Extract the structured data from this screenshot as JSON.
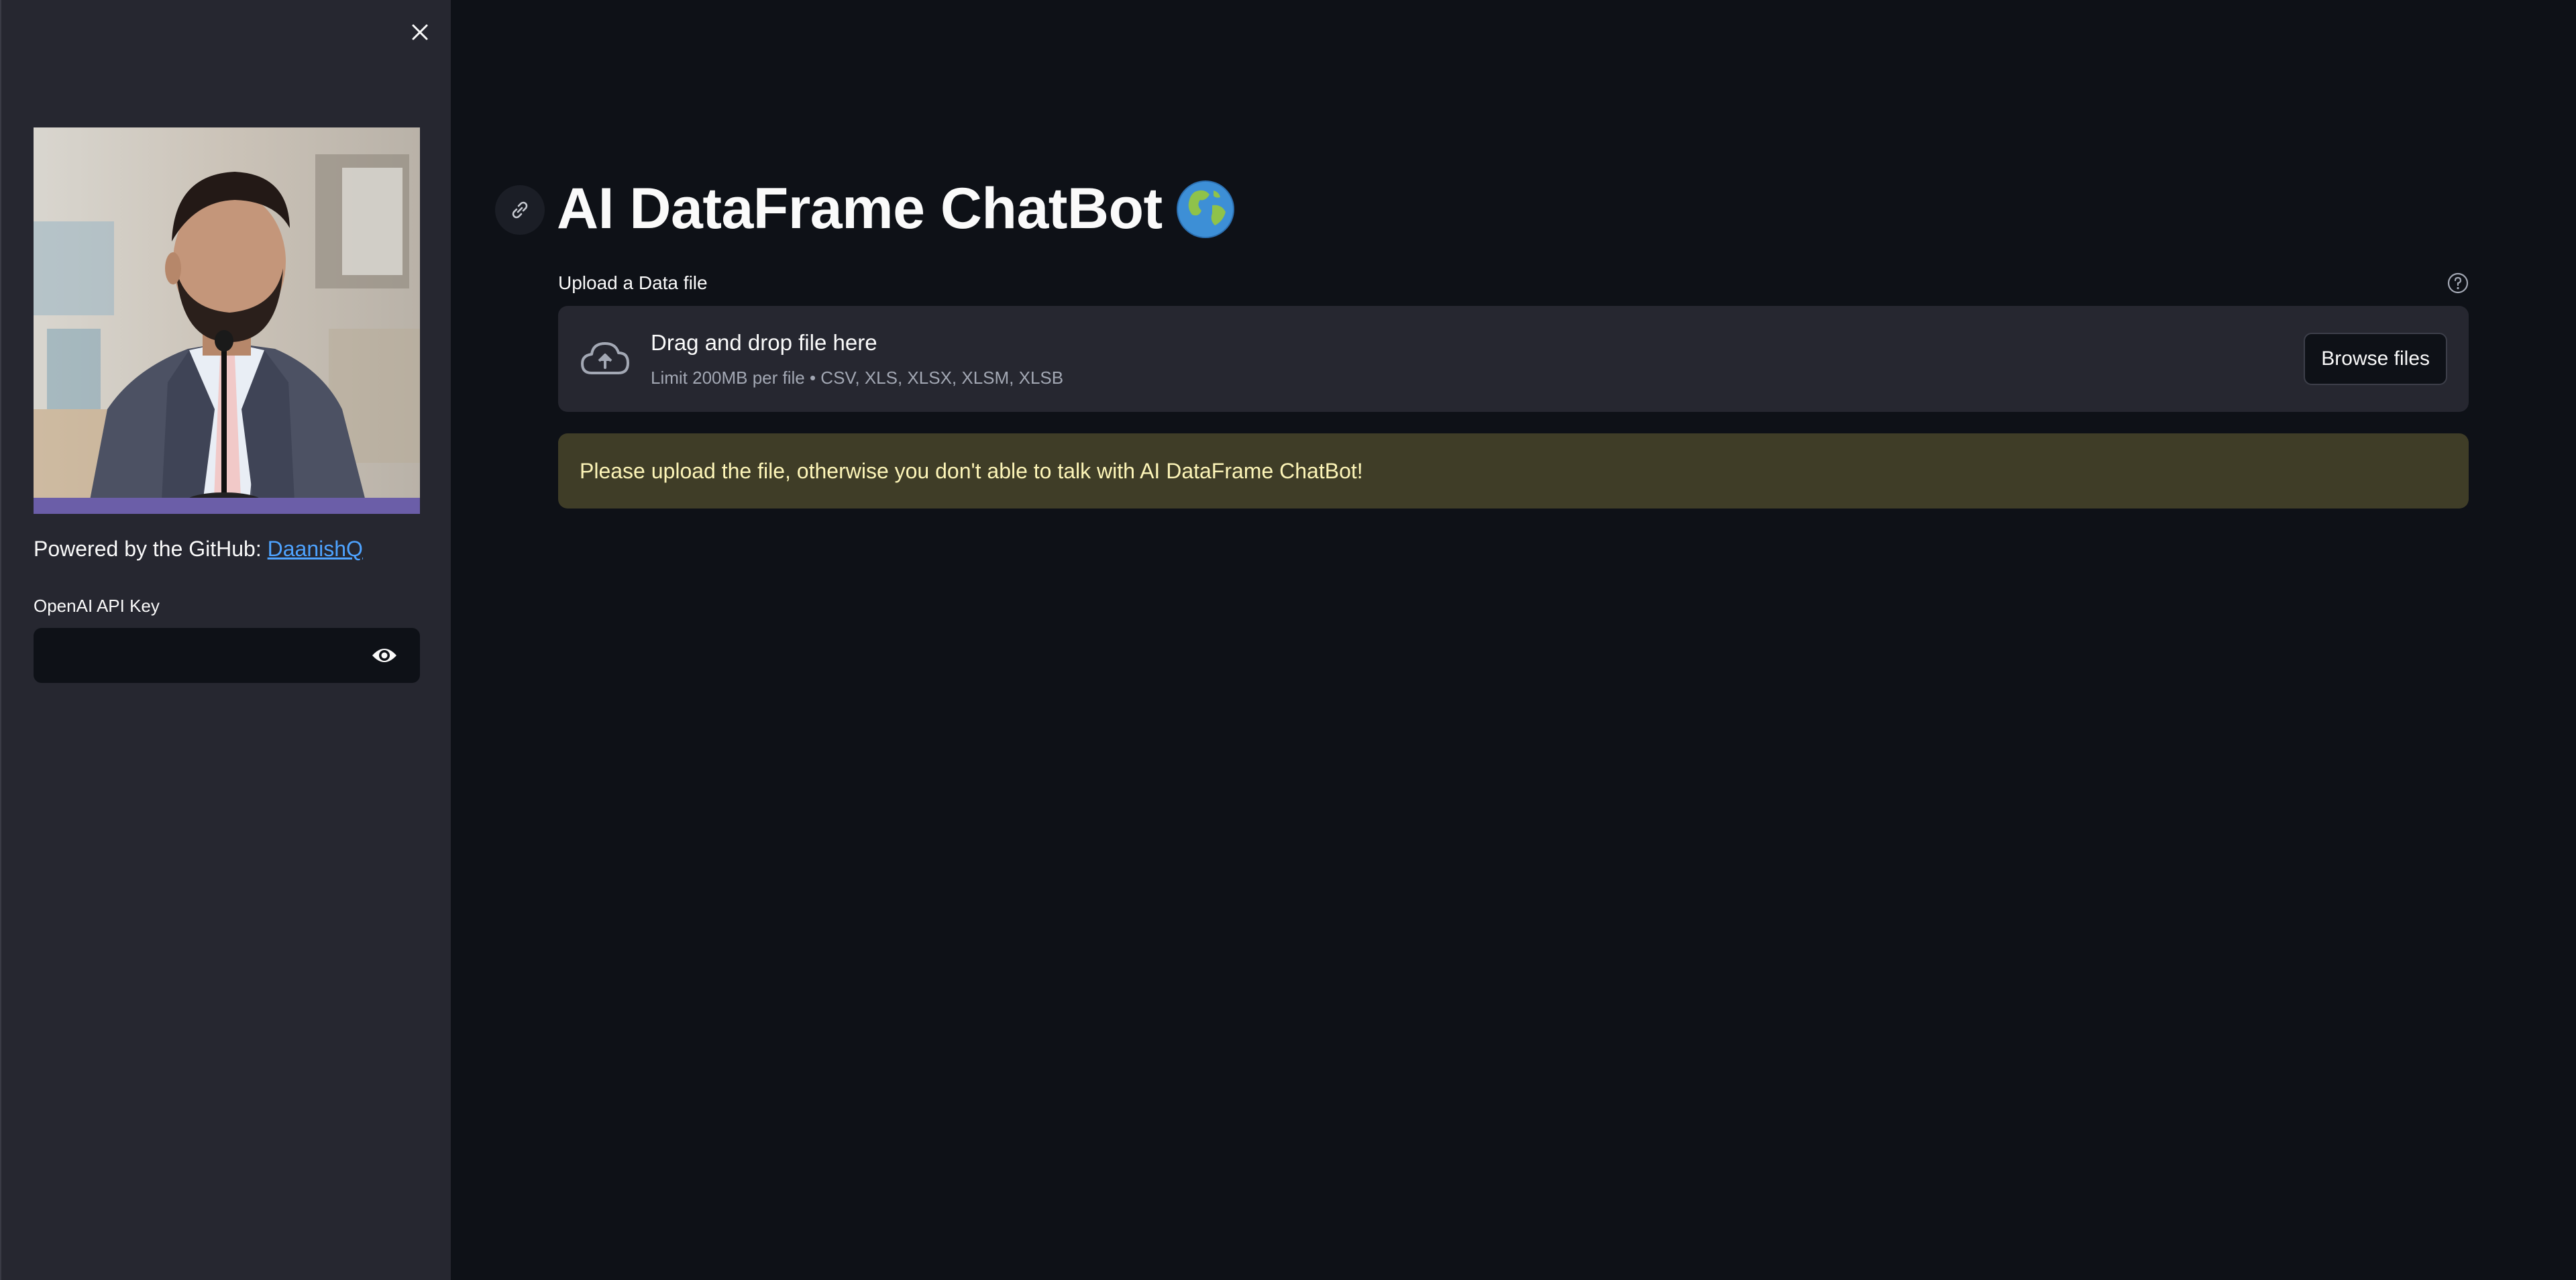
{
  "sidebar": {
    "close_icon": "close-icon",
    "powered_text": "Powered by the GitHub: ",
    "github_link": "DaanishQ",
    "api_key_label": "OpenAI API Key",
    "api_key_value": "",
    "eye_icon": "eye-icon"
  },
  "main": {
    "anchor_icon": "link-icon",
    "title": "AI DataFrame ChatBot",
    "title_icon": "globe-icon",
    "uploader": {
      "label": "Upload a Data file",
      "help_icon": "help-icon",
      "cloud_icon": "cloud-upload-icon",
      "drop_text": "Drag and drop file here",
      "limit_text": "Limit 200MB per file • CSV, XLS, XLSX, XLSM, XLSB",
      "browse_label": "Browse files"
    },
    "warning": "Please upload the file, otherwise you don't able to talk with AI DataFrame ChatBot!"
  },
  "colors": {
    "background": "#0e1117",
    "sidebar": "#262730",
    "link": "#4ea3ff",
    "warning_bg": "#3f3d27",
    "warning_text": "#fdf5b8"
  }
}
